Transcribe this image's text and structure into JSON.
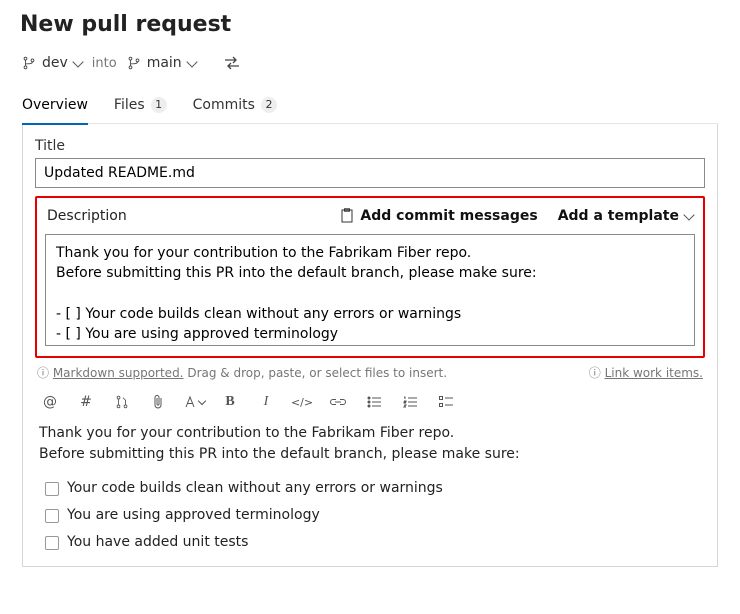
{
  "header": {
    "title": "New pull request"
  },
  "branches": {
    "from_label": "dev",
    "into_label": "into",
    "to_label": "main"
  },
  "tabs": {
    "overview": "Overview",
    "files": "Files",
    "files_count": "1",
    "commits": "Commits",
    "commits_count": "2"
  },
  "title_section": {
    "label": "Title",
    "value": "Updated README.md"
  },
  "description_section": {
    "label": "Description",
    "add_commit_messages": "Add commit messages",
    "add_template": "Add a template",
    "value": "Thank you for your contribution to the Fabrikam Fiber repo.\nBefore submitting this PR into the default branch, please make sure:\n\n- [ ] Your code builds clean without any errors or warnings\n- [ ] You are using approved terminology\n- [ ] You have added unit tests"
  },
  "hints": {
    "markdown_supported": "Markdown supported.",
    "drag_hint": " Drag & drop, paste, or select files to insert.",
    "link_work_items": "Link work items."
  },
  "preview": {
    "line1": "Thank you for your contribution to the Fabrikam Fiber repo.",
    "line2": "Before submitting this PR into the default branch, please make sure:",
    "check1": "Your code builds clean without any errors or warnings",
    "check2": "You are using approved terminology",
    "check3": "You have added unit tests"
  }
}
